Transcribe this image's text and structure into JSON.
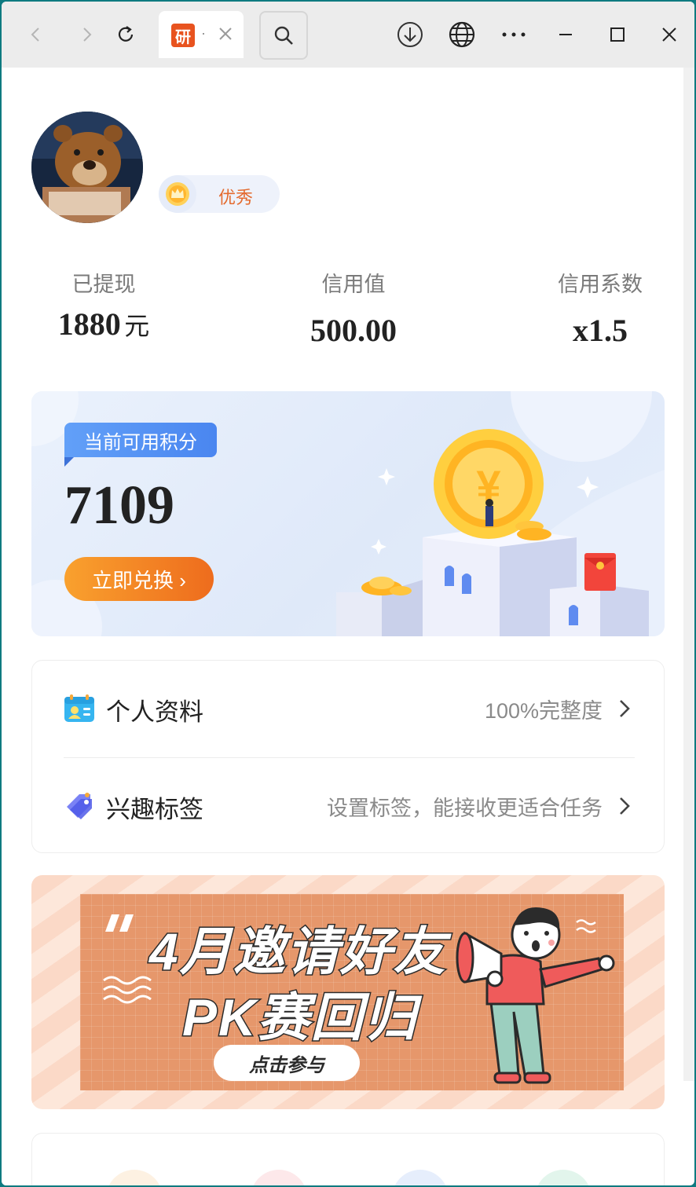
{
  "browser": {
    "tab_favicon_text": "研",
    "tab_title": "·"
  },
  "profile": {
    "level_label": "优秀"
  },
  "stats": [
    {
      "label": "已提现",
      "value": "1880",
      "unit": "元"
    },
    {
      "label": "信用值",
      "value": "500.00"
    },
    {
      "label": "信用系数",
      "value": "x1.5"
    }
  ],
  "points": {
    "label": "当前可用积分",
    "value": "7109",
    "redeem_label": "立即兑换 ›"
  },
  "menu": {
    "items": [
      {
        "title": "个人资料",
        "hint": "100%完整度"
      },
      {
        "title": "兴趣标签",
        "hint": "设置标签，能接收更适合任务"
      }
    ]
  },
  "banner": {
    "line1": "4月邀请好友",
    "line2": "PK赛回归",
    "button": "点击参与"
  },
  "colors": {
    "accent_orange": "#ee6c1d",
    "accent_blue": "#4a86f0",
    "window_border": "#0e7a80"
  }
}
